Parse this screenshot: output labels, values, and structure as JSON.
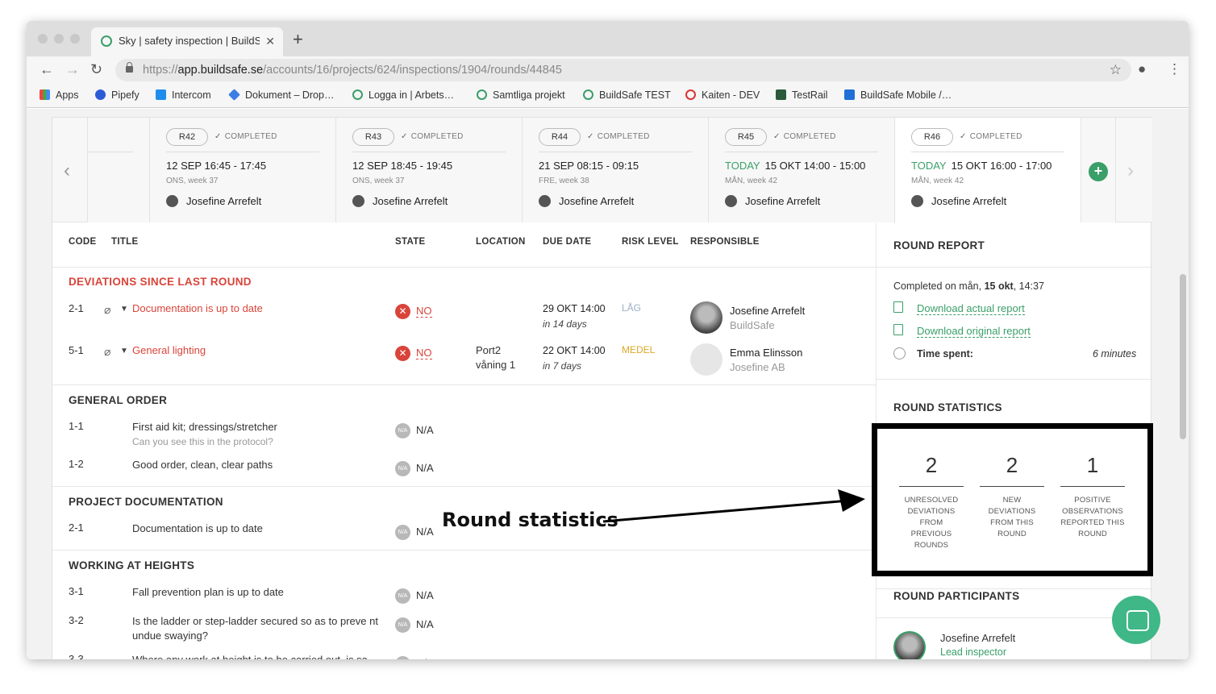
{
  "browser": {
    "tab_title": "Sky | safety inspection | BuildSafe",
    "tab_close": "✕",
    "new_tab": "+",
    "url_scheme": "https://",
    "url_host": "app.buildsafe.se",
    "url_path": "/accounts/16/projects/624/inspections/1904/rounds/44845",
    "bookmarks": [
      "Apps",
      "Pipefy",
      "Intercom",
      "Dokument – Drop…",
      "Logga in | Arbets…",
      "Samtliga projekt",
      "BuildSafe TEST",
      "Kaiten - DEV",
      "TestRail",
      "BuildSafe Mobile /…"
    ]
  },
  "rounds": [
    {
      "code": "R42",
      "status": "COMPLETED",
      "today": "",
      "date": "12 SEP",
      "time": "16:45 - 17:45",
      "week": "ONS, week 37",
      "user": "Josefine Arrefelt"
    },
    {
      "code": "R43",
      "status": "COMPLETED",
      "today": "",
      "date": "12 SEP",
      "time": "18:45 - 19:45",
      "week": "ONS, week 37",
      "user": "Josefine Arrefelt"
    },
    {
      "code": "R44",
      "status": "COMPLETED",
      "today": "",
      "date": "21 SEP",
      "time": "08:15 - 09:15",
      "week": "FRE, week 38",
      "user": "Josefine Arrefelt"
    },
    {
      "code": "R45",
      "status": "COMPLETED",
      "today": "TODAY",
      "date": "15 OKT",
      "time": "14:00 - 15:00",
      "week": "MÅN, week 42",
      "user": "Josefine Arrefelt"
    },
    {
      "code": "R46",
      "status": "COMPLETED",
      "today": "TODAY",
      "date": "15 OKT",
      "time": "16:00 - 17:00",
      "week": "MÅN, week 42",
      "user": "Josefine Arrefelt"
    }
  ],
  "table": {
    "headers": {
      "code": "CODE",
      "title": "TITLE",
      "state": "STATE",
      "location": "LOCATION",
      "due": "DUE DATE",
      "risk": "RISK LEVEL",
      "responsible": "RESPONSIBLE"
    },
    "deviations": {
      "heading": "DEVIATIONS SINCE LAST ROUND",
      "rows": [
        {
          "code": "2-1",
          "title": "Documentation is up to date",
          "state": "NO",
          "location": "",
          "due": "29 OKT 14:00",
          "due_rel": "in 14 days",
          "risk": "LÅG",
          "risk_color": "#9bb0c8",
          "resp_name": "Josefine Arrefelt",
          "resp_org": "BuildSafe"
        },
        {
          "code": "5-1",
          "title": "General lighting",
          "state": "NO",
          "location": "Port2 våning 1",
          "due": "22 OKT 14:00",
          "due_rel": "in 7 days",
          "risk": "MEDEL",
          "risk_color": "#e0a823",
          "resp_name": "Emma Elinsson",
          "resp_org": "Josefine AB"
        }
      ]
    },
    "general_order": {
      "heading": "GENERAL ORDER",
      "rows": [
        {
          "code": "1-1",
          "title": "First aid kit; dressings/stretcher",
          "sub": "Can you see this in the protocol?",
          "state": "N/A"
        },
        {
          "code": "1-2",
          "title": "Good order, clean, clear paths",
          "state": "N/A"
        }
      ]
    },
    "project_documentation": {
      "heading": "PROJECT DOCUMENTATION",
      "rows": [
        {
          "code": "2-1",
          "title": "Documentation is up to date",
          "state": "N/A"
        }
      ]
    },
    "working_at_heights": {
      "heading": "WORKING AT HEIGHTS",
      "rows": [
        {
          "code": "3-1",
          "title": "Fall prevention plan is up to date",
          "state": "N/A"
        },
        {
          "code": "3-2",
          "title": "Is the ladder or step-ladder secured so as to preve nt undue swaying?",
          "state": "N/A"
        },
        {
          "code": "3-3",
          "title": "Where any work at height is to be carried out, is sa",
          "state": "N/A"
        }
      ]
    },
    "na_icon": "N/A"
  },
  "report": {
    "heading": "ROUND REPORT",
    "completed_prefix": "Completed on mån, ",
    "completed_date": "15 okt",
    "completed_time": ", 14:37",
    "download_actual": "Download actual report",
    "download_original": "Download original report",
    "time_spent_label": "Time spent:",
    "time_spent_value": "6 minutes"
  },
  "statistics": {
    "heading": "ROUND STATISTICS",
    "items": [
      {
        "value": "2",
        "label": "UNRESOLVED DEVIATIONS FROM PREVIOUS ROUNDS"
      },
      {
        "value": "2",
        "label": "NEW DEVIATIONS FROM THIS ROUND"
      },
      {
        "value": "1",
        "label": "POSITIVE OBSERVATIONS REPORTED THIS ROUND"
      }
    ]
  },
  "participants": {
    "heading": "ROUND PARTICIPANTS",
    "name": "Josefine Arrefelt",
    "role": "Lead inspector"
  },
  "annotation": "Round statistics",
  "colors": {
    "brand": "#3a9f68",
    "danger": "#d9443a",
    "risk_low": "#9bb0c8",
    "risk_medium": "#e0a823"
  }
}
